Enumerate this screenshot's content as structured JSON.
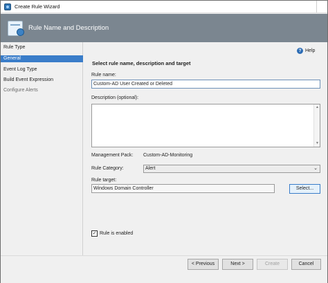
{
  "window": {
    "title": "Create Rule Wizard"
  },
  "banner": {
    "title": "Rule Name and Description"
  },
  "nav": {
    "items": [
      {
        "label": "Rule Type"
      },
      {
        "label": "General"
      },
      {
        "label": "Event Log Type"
      },
      {
        "label": "Build Event Expression"
      },
      {
        "label": "Configure Alerts"
      }
    ],
    "selected": "General"
  },
  "help": {
    "label": "Help"
  },
  "form": {
    "heading": "Select rule name, description and target",
    "rule_name_label": "Rule name:",
    "rule_name_value": "Custom-AD User Created or Deleted",
    "description_label": "Description (optional):",
    "description_value": "",
    "management_pack_label": "Management Pack:",
    "management_pack_value": "Custom-AD-Monitoring",
    "rule_category_label": "Rule Category:",
    "rule_category_value": "Alert",
    "rule_target_label": "Rule target:",
    "rule_target_value": "Windows Domain Controller",
    "select_button": "Select...",
    "rule_enabled_label": "Rule is enabled",
    "rule_enabled_checked": true
  },
  "footer": {
    "previous": "< Previous",
    "next": "Next >",
    "create": "Create",
    "cancel": "Cancel"
  }
}
